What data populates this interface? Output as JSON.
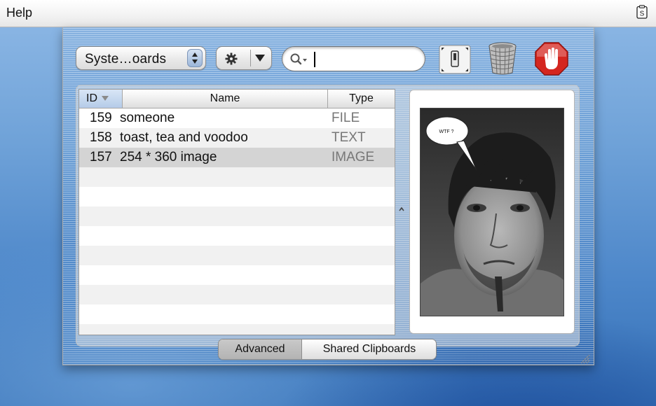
{
  "menubar": {
    "help_label": "Help",
    "status_icon": "clipboard-s-icon"
  },
  "toolbar": {
    "clipboard_popup": {
      "selected": "Syste…oards"
    },
    "action_menu": {
      "icon": "gear-icon"
    },
    "search": {
      "value": "",
      "placeholder": ""
    },
    "toggle_icon": "toggle-switch-icon",
    "trash_icon": "trash-icon",
    "stop_icon": "stop-hand-icon"
  },
  "table": {
    "columns": {
      "id": "ID",
      "name": "Name",
      "type": "Type"
    },
    "rows": [
      {
        "id": "159",
        "name": "someone",
        "type": "FILE",
        "selected": false
      },
      {
        "id": "158",
        "name": "toast, tea and voodoo",
        "type": "TEXT",
        "selected": false
      },
      {
        "id": "157",
        "name": "254 * 360 image",
        "type": "IMAGE",
        "selected": true
      }
    ]
  },
  "preview": {
    "speech_bubble": "WTF ?"
  },
  "tabs": {
    "advanced": "Advanced",
    "shared": "Shared Clipboards"
  }
}
